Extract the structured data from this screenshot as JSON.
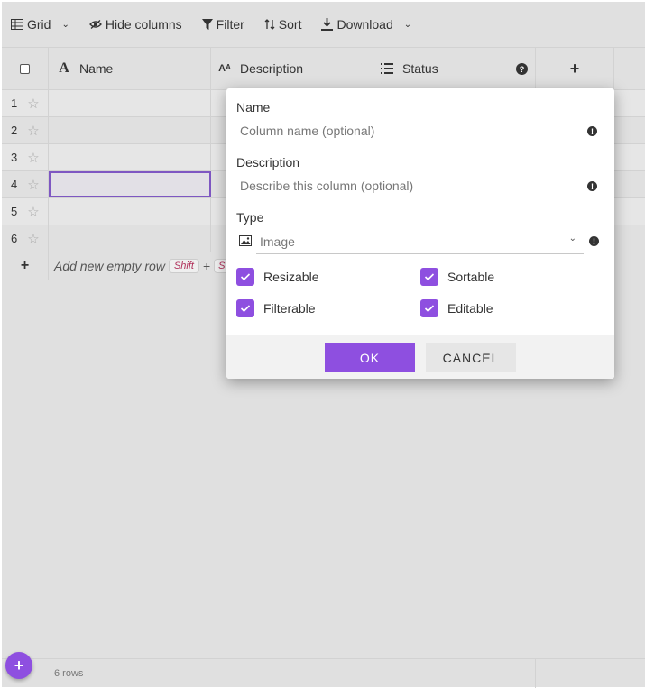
{
  "toolbar": {
    "grid": "Grid",
    "hide_columns": "Hide columns",
    "filter": "Filter",
    "sort": "Sort",
    "download": "Download"
  },
  "columns": {
    "name": "Name",
    "description": "Description",
    "status": "Status",
    "status_help": "?",
    "add": "+"
  },
  "rows": [
    {
      "num": "1"
    },
    {
      "num": "2"
    },
    {
      "num": "3"
    },
    {
      "num": "4"
    },
    {
      "num": "5"
    },
    {
      "num": "6"
    }
  ],
  "add_row": {
    "plus": "+",
    "label": "Add new empty row",
    "shortcut": "Shift",
    "sep": "+",
    "shortcut2": "S"
  },
  "footer": {
    "row_count": "6 rows",
    "fab": "+"
  },
  "dialog": {
    "name_label": "Name",
    "name_placeholder": "Column name (optional)",
    "description_label": "Description",
    "description_placeholder": "Describe this column (optional)",
    "type_label": "Type",
    "type_value": "Image",
    "warn": "!",
    "checkboxes": {
      "resizable": "Resizable",
      "sortable": "Sortable",
      "filterable": "Filterable",
      "editable": "Editable"
    },
    "ok": "OK",
    "cancel": "CANCEL"
  },
  "colors": {
    "accent": "#8e4fe0",
    "selection": "#7e57c2",
    "background": "#e0e0e0"
  }
}
